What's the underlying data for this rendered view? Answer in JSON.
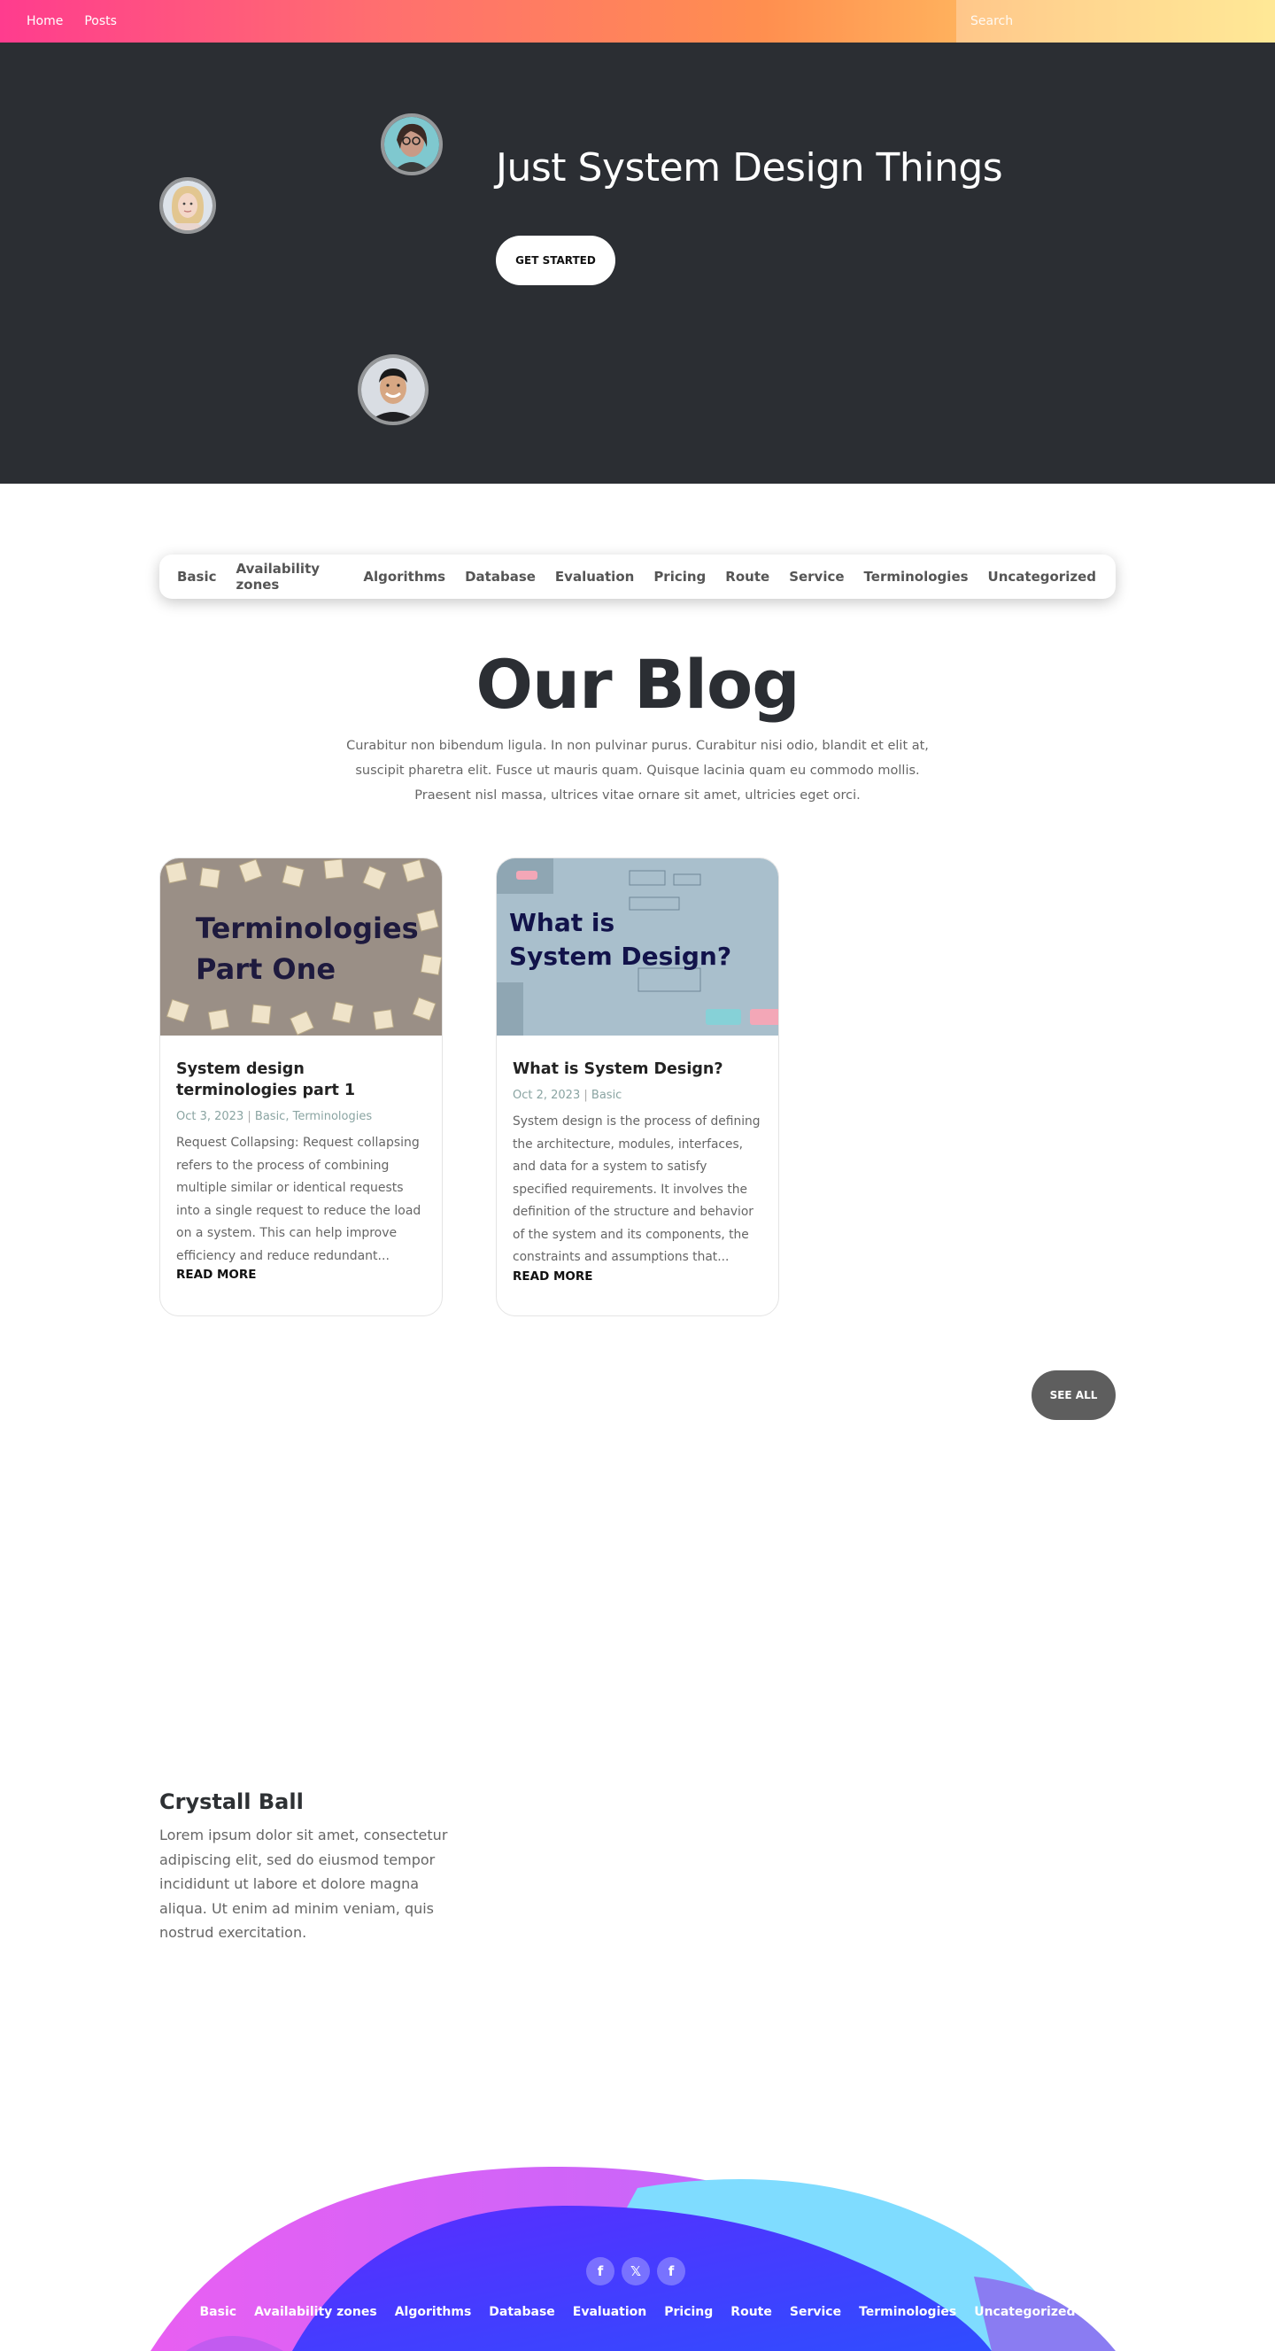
{
  "topbar": {
    "nav": [
      {
        "label": "Home"
      },
      {
        "label": "Posts"
      }
    ],
    "search_placeholder": "Search"
  },
  "hero": {
    "title": "Just System Design Things",
    "button_label": "GET STARTED"
  },
  "categories": [
    "Basic",
    "Availability zones",
    "Algorithms",
    "Database",
    "Evaluation",
    "Pricing",
    "Route",
    "Service",
    "Terminologies",
    "Uncategorized"
  ],
  "blog": {
    "title": "Our Blog",
    "subtitle": "Curabitur non bibendum ligula. In non pulvinar purus. Curabitur nisi odio, blandit et elit at, suscipit pharetra elit. Fusce ut mauris quam. Quisque lacinia quam eu commodo mollis. Praesent nisl massa, ultrices vitae ornare sit amet, ultricies eget orci."
  },
  "posts": [
    {
      "image_text": [
        "Terminologies",
        "Part One"
      ],
      "title": "System design terminologies part 1",
      "date": "Oct 3, 2023",
      "tags": "Basic, Terminologies",
      "excerpt": "Request Collapsing: Request collapsing refers to the process of combining multiple similar or identical requests into a single request to reduce the load on a system. This can help improve efficiency and reduce redundant...",
      "read_more": "READ MORE"
    },
    {
      "image_text": [
        "What is",
        "System Design?"
      ],
      "title": "What is System Design?",
      "date": "Oct 2, 2023",
      "tags": "Basic",
      "excerpt": "System design is the process of defining the architecture, modules, interfaces, and data for a system to satisfy specified requirements. It involves the definition of the structure and behavior of the system and its components, the constraints and assumptions that...",
      "read_more": "READ MORE"
    }
  ],
  "see_all_label": "SEE ALL",
  "crystall": {
    "title": "Crystall Ball",
    "text": "Lorem ipsum dolor sit amet, consectetur adipiscing elit, sed do eiusmod tempor incididunt ut labore et dolore magna aliqua. Ut enim ad minim veniam, quis nostrud exercitation."
  },
  "footer": {
    "social": [
      {
        "icon": "facebook-icon",
        "glyph": "f"
      },
      {
        "icon": "x-twitter-icon",
        "glyph": "𝕏"
      },
      {
        "icon": "facebook-icon",
        "glyph": "f"
      }
    ],
    "nav": [
      "Basic",
      "Availability zones",
      "Algorithms",
      "Database",
      "Evaluation",
      "Pricing",
      "Route",
      "Service",
      "Terminologies",
      "Uncategorized"
    ]
  },
  "colors": {
    "hero_bg": "#2b2e33",
    "accent_pink": "#ff3c8e",
    "accent_yellow": "#ffe06e",
    "meta_teal": "#8aa4a2",
    "see_all_bg": "#5e5e5e"
  }
}
